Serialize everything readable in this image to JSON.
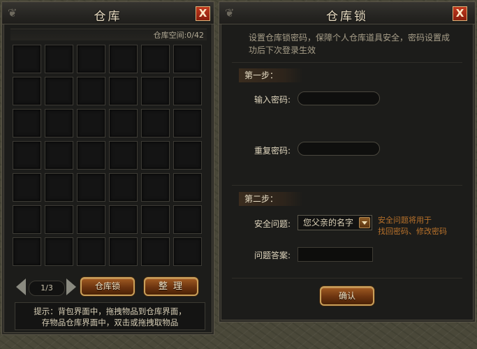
{
  "warehouse": {
    "title": "仓库",
    "close_label": "X",
    "space_label": "仓库空间:0/42",
    "rows": 7,
    "cols": 6,
    "page_indicator": "1/3",
    "lock_button": "仓库锁",
    "sort_button": "整  理",
    "hint_line1": "提示：背包界面中，拖拽物品到仓库界面，",
    "hint_line2": "存物品仓库界面中，双击或拖拽取物品"
  },
  "lock": {
    "title": "仓库锁",
    "close_label": "X",
    "description": "设置仓库锁密码，保障个人仓库道具安全，密码设置成功后下次登录生效",
    "step1": "第一步：",
    "password_label": "输入密码:",
    "repeat_label": "重复密码:",
    "step2": "第二步：",
    "question_label": "安全问题:",
    "question_value": "您父亲的名字",
    "question_note_line1": "安全问题将用于",
    "question_note_line2": "找回密码、修改密码",
    "answer_label": "问题答案:",
    "confirm_button": "确认"
  }
}
